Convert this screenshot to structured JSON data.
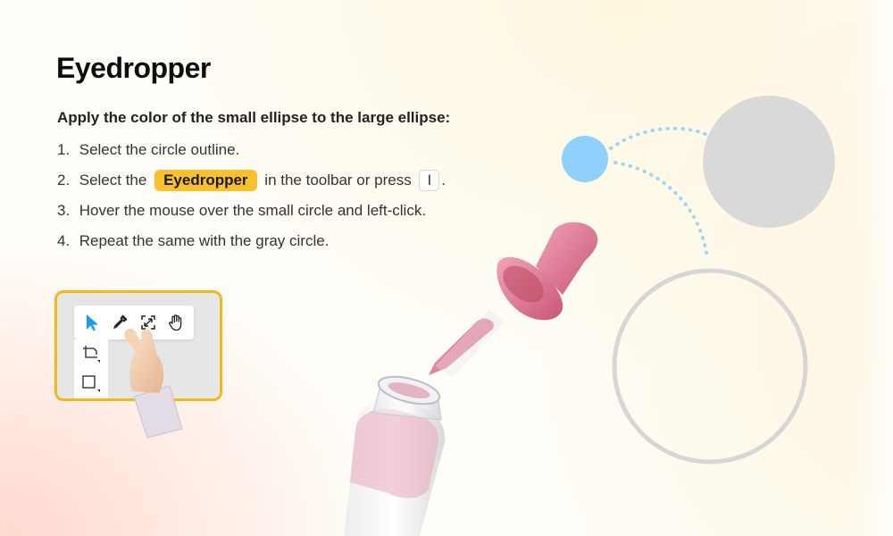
{
  "title": "Eyedropper",
  "instructions": {
    "heading": "Apply the color of the small ellipse to the large ellipse:",
    "steps": [
      {
        "num": "1.",
        "text": "Select the circle outline."
      },
      {
        "num": "2.",
        "before": "Select the",
        "highlight": "Eyedropper",
        "middle": "in the toolbar or press",
        "key": "I",
        "after": "."
      },
      {
        "num": "3.",
        "text": "Hover the mouse over the small circle and left-click."
      },
      {
        "num": "4.",
        "text": "Repeat the same with the gray circle."
      }
    ]
  },
  "toolbar": {
    "tools": [
      {
        "name": "select-tool",
        "icon": "pointer-arrow-icon",
        "color": "#1e9be9"
      },
      {
        "name": "eyedropper-tool",
        "icon": "eyedropper-icon"
      },
      {
        "name": "resize-tool",
        "icon": "expand-arrows-icon"
      },
      {
        "name": "hand-tool",
        "icon": "hand-icon"
      }
    ],
    "side_tools": [
      {
        "name": "frame-tool",
        "icon": "frame-crop-icon"
      },
      {
        "name": "rectangle-tool",
        "icon": "square-icon"
      }
    ]
  },
  "colors": {
    "accent": "#f9c12f",
    "demo_border": "#f4b71c",
    "small_circle": "#8ed1fc",
    "gray_circle": "#d9d9d9",
    "outline_circle": "#d6d6d6",
    "dotted_path": "#9ed6f3",
    "dropper_pink": "#e47d9b"
  }
}
